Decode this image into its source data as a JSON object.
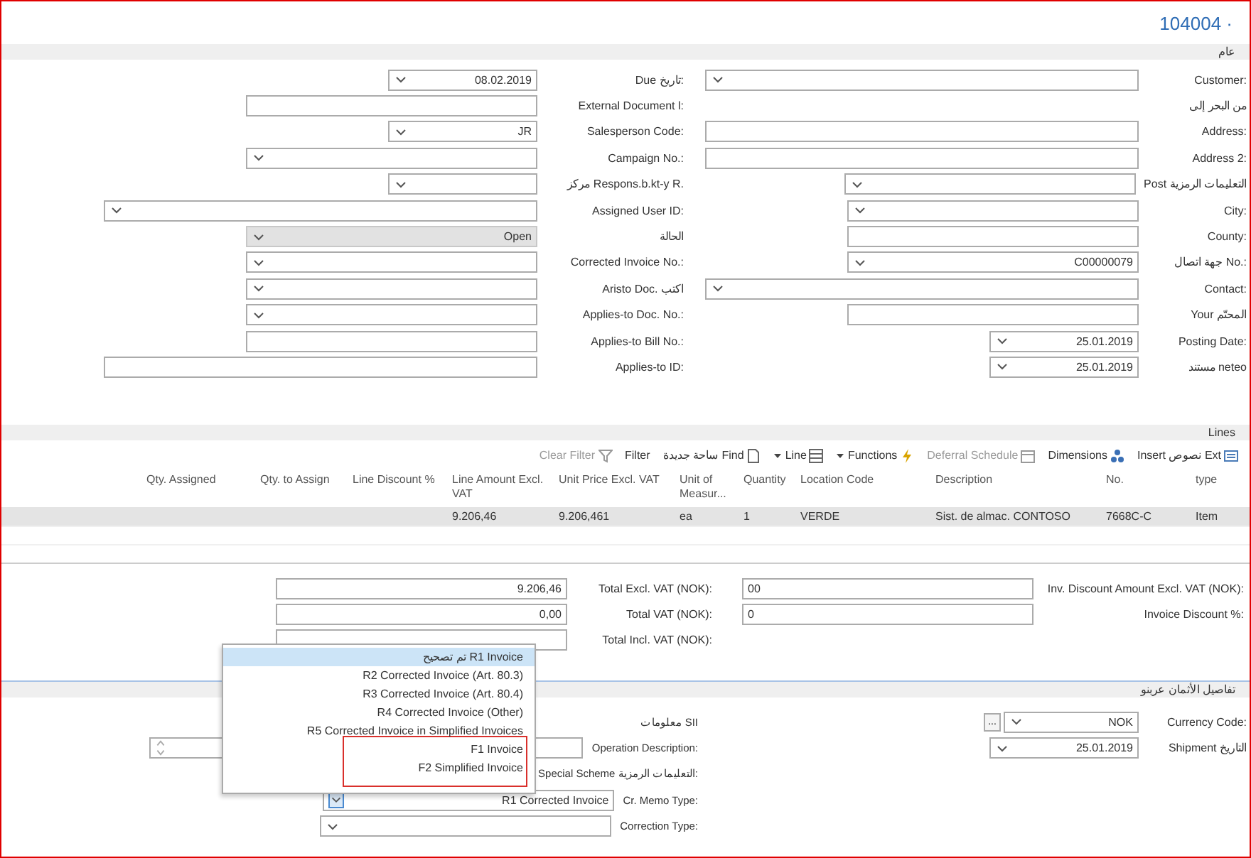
{
  "title": "104004 ·",
  "general": {
    "heading": "عام",
    "right": [
      {
        "label": "Customer:",
        "kind": "dropdown",
        "disabled": false
      },
      {
        "label": "من البحر إلى",
        "kind": "label",
        "disabled": false
      },
      {
        "label": "Address:",
        "kind": "text",
        "disabled": false
      },
      {
        "label": "Address 2:",
        "kind": "text",
        "disabled": false
      },
      {
        "label": "Post التعليمات الرمزية",
        "kind": "dropdown",
        "disabled": false
      },
      {
        "label": "City:",
        "kind": "dropdown",
        "disabled": false
      },
      {
        "label": "County:",
        "kind": "text",
        "disabled": false
      },
      {
        "label": "جهة اتصال No.:",
        "kind": "dropdown",
        "value": "C00000079",
        "disabled": false
      },
      {
        "label": "Contact:",
        "kind": "dropdown",
        "disabled": false
      },
      {
        "label": "Your المحتّم",
        "kind": "text",
        "disabled": false
      },
      {
        "label": "Posting Date:",
        "kind": "dropdown",
        "value": "25.01.2019",
        "disabled": false
      },
      {
        "label": "مستند neteo",
        "kind": "dropdown",
        "value": "25.01.2019",
        "disabled": false
      }
    ],
    "left": [
      {
        "label": "Due تاريخ:",
        "kind": "dropdown",
        "value": "08.02.2019",
        "disabled": false
      },
      {
        "label": "External Document l:",
        "kind": "text",
        "disabled": false
      },
      {
        "label": "Salesperson Code:",
        "kind": "dropdown",
        "value": "JR",
        "disabled": false
      },
      {
        "label": "Campaign No.:",
        "kind": "dropdown",
        "disabled": false
      },
      {
        "label": "مركز Respons.b.kt-y R.",
        "kind": "dropdown",
        "disabled": false
      },
      {
        "label": "Assigned User ID:",
        "kind": "dropdown",
        "disabled": false
      },
      {
        "label": "الحالة",
        "kind": "dropdown",
        "value": "Open",
        "disabled": true
      },
      {
        "label": "Corrected Invoice No.:",
        "kind": "dropdown",
        "disabled": false
      },
      {
        "label": "Aristo Doc. اكتب",
        "kind": "dropdown",
        "disabled": false
      },
      {
        "label": "Applies-to Doc. No.:",
        "kind": "dropdown",
        "disabled": false
      },
      {
        "label": "Applies-to Bill No.:",
        "kind": "text",
        "disabled": false
      },
      {
        "label": "Applies-to ID:",
        "kind": "text",
        "disabled": false
      }
    ]
  },
  "lines": {
    "heading": "Lines",
    "toolbar": [
      {
        "label": "Clear Filter",
        "menu": false,
        "disabled": true
      },
      {
        "label": "Filter",
        "menu": false,
        "disabled": false
      },
      {
        "label": "ساحة جديدة Find",
        "menu": false,
        "disabled": false
      },
      {
        "label": "Line",
        "menu": true,
        "disabled": false
      },
      {
        "label": "Functions",
        "menu": true,
        "disabled": false
      },
      {
        "label": "Deferral Schedule",
        "menu": false,
        "disabled": true
      },
      {
        "label": "Dimensions",
        "menu": false,
        "disabled": false
      },
      {
        "label": "Insert نصوص Ext",
        "menu": false,
        "disabled": false
      }
    ],
    "columns": [
      "Qty. Assigned",
      "Qty. to Assign",
      "Line Discount %",
      "Line Amount Excl. VAT",
      "Unit Price Excl. VAT",
      "Unit of Measur...",
      "Quantity",
      "Location Code",
      "Description",
      "No.",
      "type"
    ],
    "rows": [
      {
        "selected": true,
        "cells": [
          "",
          "",
          "",
          "9.206,46",
          "9.206,461",
          "ea",
          "1",
          "VERDE",
          "Sist. de almac. CONTOSO",
          "7668C-C",
          "Item"
        ]
      }
    ]
  },
  "totals": {
    "right": [
      {
        "label": "Inv. Discount Amount Excl. VAT (NOK):",
        "value": "00"
      },
      {
        "label": "Invoice Discount %:",
        "value": "0"
      }
    ],
    "left": [
      {
        "label": "Total Excl. VAT (NOK):",
        "value": "9.206,46"
      },
      {
        "label": "Total VAT (NOK):",
        "value": "0,00"
      },
      {
        "label": "Total Incl. VAT (NOK):"
      }
    ]
  },
  "details": {
    "heading": "تفاصيل الأثمان عربنو",
    "right": [
      {
        "label": "Currency Code:",
        "kind": "dropdown",
        "value": "NOK",
        "lookup": "..."
      },
      {
        "label": "Shipment التاريخ",
        "kind": "dropdown",
        "value": "25.01.2019"
      }
    ],
    "left": [
      {
        "label": "معلومات SII",
        "kind": "label"
      },
      {
        "label": "Operation Description:",
        "kind": "spin"
      },
      {
        "label": "Special Scheme التعليمات الرمزية:",
        "kind": "label"
      },
      {
        "label": "Cr. Memo Type:",
        "kind": "dropdown",
        "value": "R1 Corrected Invoice",
        "options": [
          {
            "label": "تم تصحيح R1 Invoice",
            "selected": true,
            "highlighted": false
          },
          {
            "label": "R2 Corrected Invoice (Art. 80.3)",
            "selected": false,
            "highlighted": false
          },
          {
            "label": "R3 Corrected Invoice (Art. 80.4)",
            "selected": false,
            "highlighted": false
          },
          {
            "label": "R4 Corrected Invoice (Other)",
            "selected": false,
            "highlighted": false
          },
          {
            "label": "R5 Corrected Invoice in Simplified Invoices",
            "selected": false,
            "highlighted": false
          },
          {
            "label": "F1 Invoice",
            "selected": false,
            "highlighted": true
          },
          {
            "label": "F2 Simplified Invoice",
            "selected": false,
            "highlighted": true
          }
        ]
      },
      {
        "label": "Correction Type:",
        "kind": "dropdown"
      }
    ]
  }
}
